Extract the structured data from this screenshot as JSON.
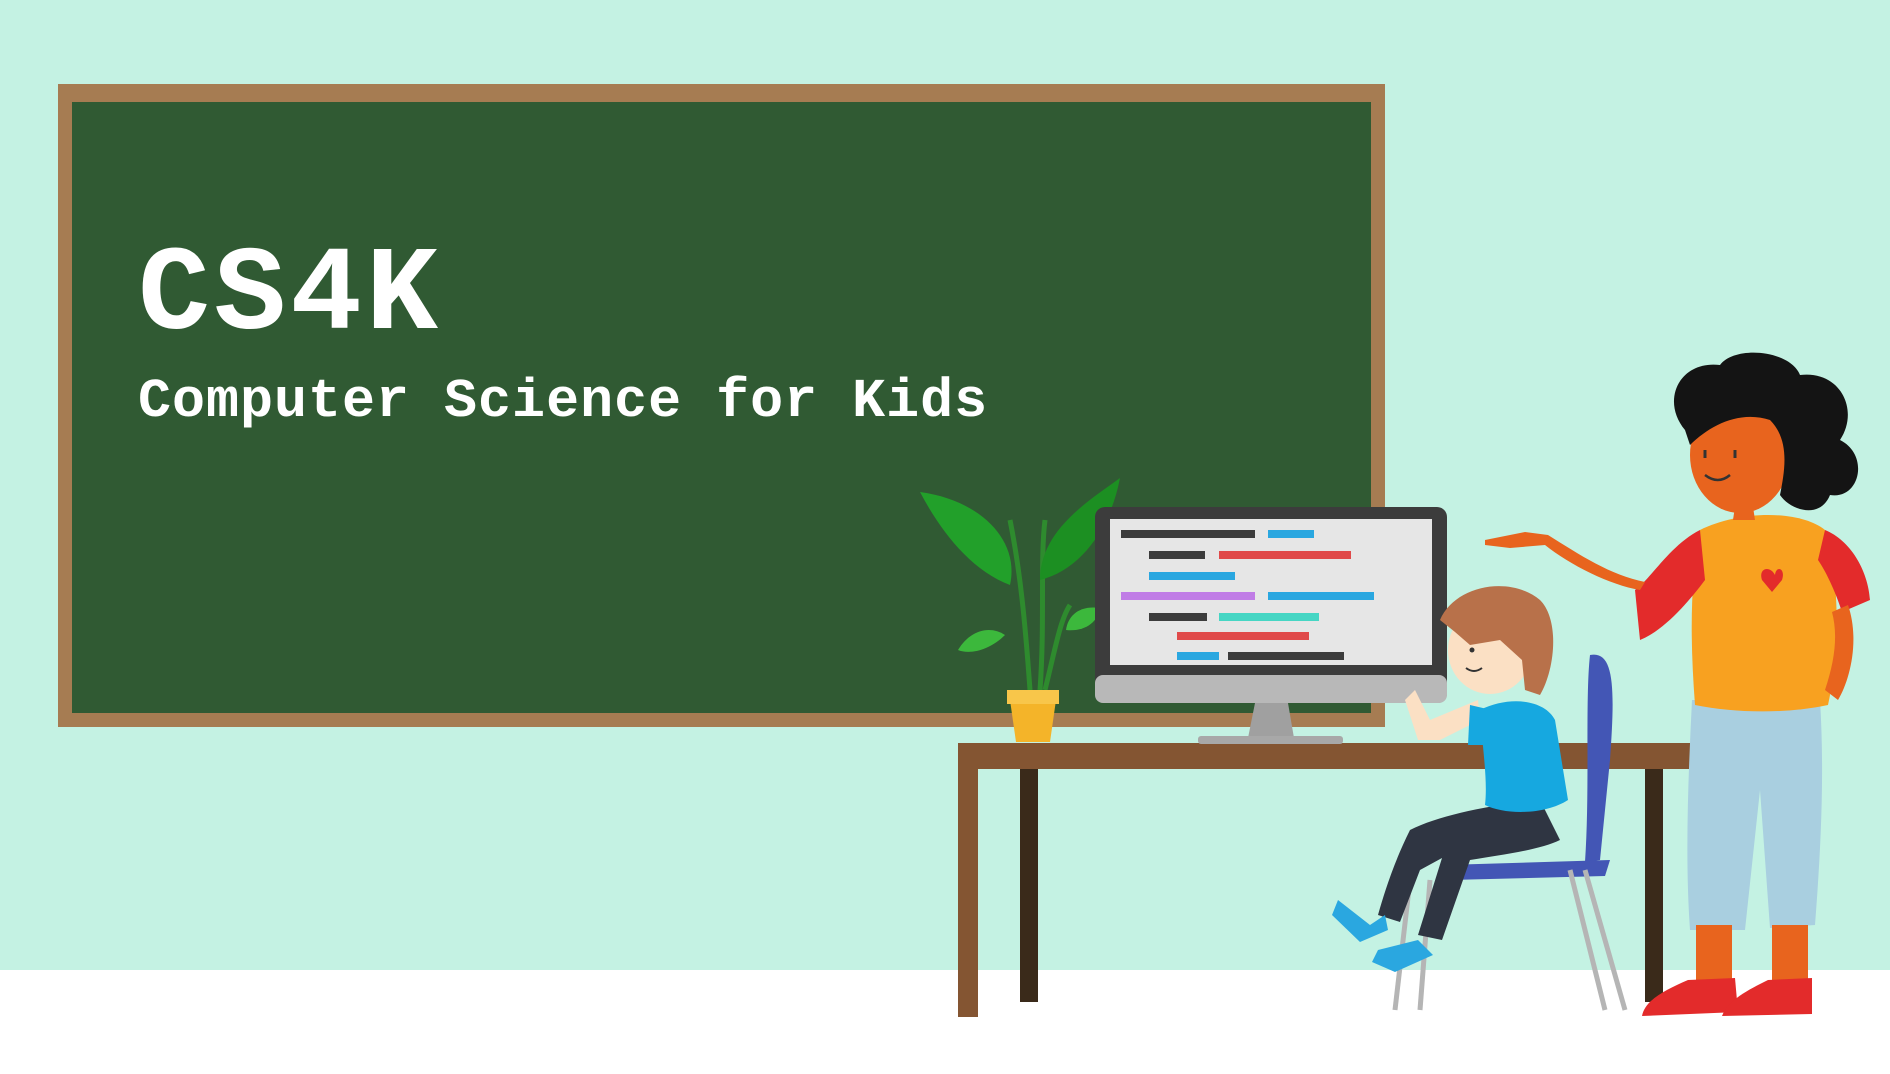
{
  "board": {
    "title": "CS4K",
    "subtitle": "Computer Science for Kids"
  },
  "illustration": {
    "icons": [
      "plant-icon",
      "monitor-icon",
      "desk-icon",
      "chair-icon",
      "child-icon",
      "teacher-icon"
    ]
  },
  "colors": {
    "background": "#c4f2e3",
    "chalkboard": "#305a33",
    "frame": "#a67c52",
    "desk": "#845532"
  }
}
